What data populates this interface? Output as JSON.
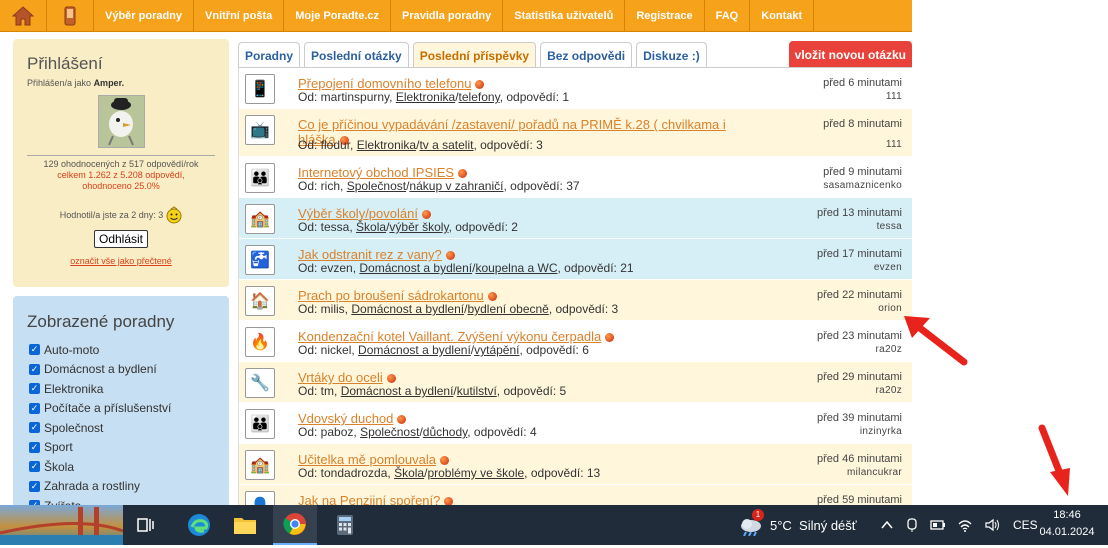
{
  "nav": {
    "items": [
      "Výběr poradny",
      "Vnitřní pošta",
      "Moje Poradte.cz",
      "Pravidla poradny",
      "Statistika uživatelů",
      "Registrace",
      "FAQ",
      "Kontakt"
    ],
    "home_icon": "home-icon",
    "phone_icon": "phone-icon"
  },
  "login": {
    "title": "Přihlášení",
    "as_prefix": "Přihlášen/a jako",
    "username": "Amper.",
    "stats_line1": "129 ohodnocených z 517 odpovědí/rok",
    "stats_line2": "celkem 1.262 z 5.208 odpovědí,",
    "stats_line3": "ohodnoceno 25.0%",
    "rated_text": "Hodnotil/a jste za 2 dny: 3",
    "logout_label": "Odhlásit",
    "mark_read_label": "označit vše jako přečtené"
  },
  "categories": {
    "title": "Zobrazené poradny",
    "items": [
      "Auto-moto",
      "Domácnost a bydlení",
      "Elektronika",
      "Počítače a příslušenství",
      "Společnost",
      "Sport",
      "Škola",
      "Zahrada a rostliny",
      "Zvířata"
    ]
  },
  "tabs": {
    "items": [
      "Poradny",
      "Poslední otázky",
      "Poslední příspěvky",
      "Bez odpovědi",
      "Diskuze :)"
    ],
    "active": "Poslední příspěvky",
    "new_question": "vložit novou otázku"
  },
  "posts": [
    {
      "title": "Přepojení domovního telefonu",
      "from": "Od: martinspurny,",
      "cat": "Elektronika",
      "sub": "telefony",
      "answers": ", odpovědí: 1",
      "time": "před 6 minutami",
      "user": "111",
      "icon": "phone-icon",
      "bg": "white"
    },
    {
      "title": "Co je příčinou vypadávání /zastavení/ pořadů na PRIMĚ k.28 ( chvilkama i hláška",
      "from": "Od: flodur,",
      "cat": "Elektronika",
      "sub": "tv a satelit",
      "answers": ", odpovědí: 3",
      "time": "před 8 minutami",
      "user": "111",
      "icon": "tv-icon",
      "bg": "cream"
    },
    {
      "title": "Internetový obchod IPSIES",
      "from": "Od: rich,",
      "cat": "Společnost",
      "sub": "nákup v zahraničí",
      "answers": ", odpovědí: 37",
      "time": "před 9 minutami",
      "user": "sasamaznicenko",
      "icon": "people-icon",
      "bg": "white"
    },
    {
      "title": "Výběr školy/povolání",
      "from": "Od: tessa,",
      "cat": "Škola",
      "sub": "výběr školy",
      "answers": ", odpovědí: 2",
      "time": "před 13 minutami",
      "user": "tessa",
      "icon": "school-icon",
      "bg": "blue"
    },
    {
      "title": "Jak odstranit rez z vany?",
      "from": "Od: evzen,",
      "cat": "Domácnost a bydlení",
      "sub": "koupelna a WC",
      "answers": ", odpovědí: 21",
      "time": "před 17 minutami",
      "user": "evzen",
      "icon": "faucet-icon",
      "bg": "blue"
    },
    {
      "title": "Prach po broušení sádrokartonu",
      "from": "Od: milis,",
      "cat": "Domácnost a bydlení",
      "sub": "bydlení obecně",
      "answers": ", odpovědí: 3",
      "time": "před 22 minutami",
      "user": "orion",
      "icon": "house-icon",
      "bg": "cream"
    },
    {
      "title": "Kondenzační kotel Vaillant. Zvýšení výkonu čerpadla",
      "from": "Od: nickel,",
      "cat": "Domácnost a bydlení",
      "sub": "vytápění",
      "answers": ", odpovědí: 6",
      "time": "před 23 minutami",
      "user": "ra20z",
      "icon": "fireplace-icon",
      "bg": "white"
    },
    {
      "title": "Vrtáky do oceli",
      "from": "Od: tm,",
      "cat": "Domácnost a bydlení",
      "sub": "kutilství",
      "answers": ", odpovědí: 5",
      "time": "před 29 minutami",
      "user": "ra20z",
      "icon": "drill-icon",
      "bg": "cream"
    },
    {
      "title": "Vdovský duchod",
      "from": "Od: paboz,",
      "cat": "Společnost",
      "sub": "důchody",
      "answers": ", odpovědí: 4",
      "time": "před 39 minutami",
      "user": "inzinyrka",
      "icon": "people-icon",
      "bg": "white"
    },
    {
      "title": "Učitelka mě pomlouvala",
      "from": "Od: tondadrozda,",
      "cat": "Škola",
      "sub": "problémy ve škole",
      "answers": ", odpovědí: 13",
      "time": "před 46 minutami",
      "user": "milancukrar",
      "icon": "school-icon",
      "bg": "cream"
    },
    {
      "title": "Jak na Penzijní spoření?",
      "from": "",
      "cat": "",
      "sub": "",
      "answers": "",
      "time": "před 59 minutami",
      "user": "",
      "icon": "person-icon",
      "bg": "cream"
    }
  ],
  "taskbar": {
    "weather": "5°C  Silný déšť",
    "weather_badge": "1",
    "lang": "CES",
    "time": "18:46",
    "date": "04.01.2024"
  },
  "colors": {
    "nav": "#f7a21b",
    "accent": "#d9822b",
    "new_question": "#e8423a",
    "arrow": "#e8231b"
  }
}
